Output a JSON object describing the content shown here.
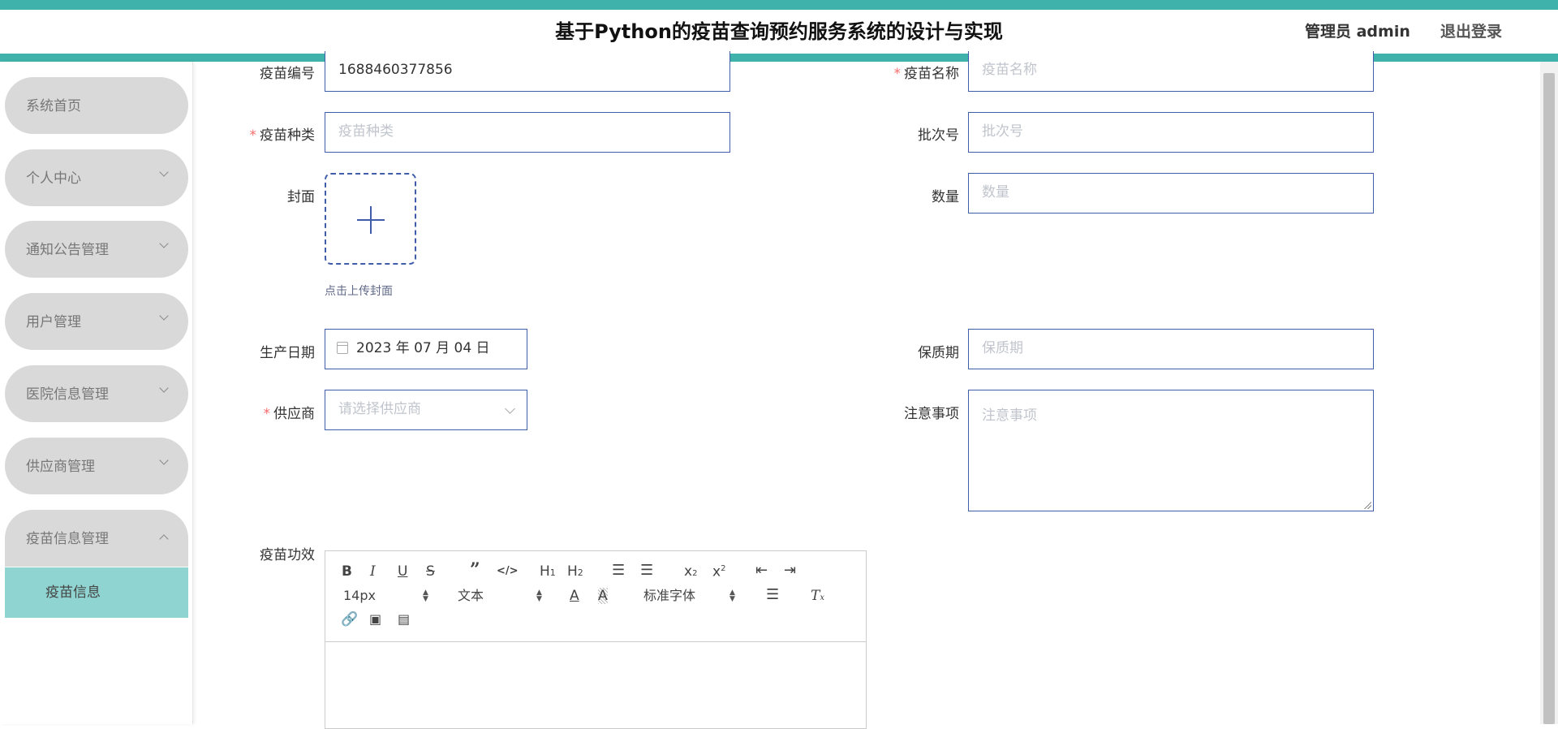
{
  "header": {
    "title": "基于Python的疫苗查询预约服务系统的设计与实现",
    "admin_label": "管理员 admin",
    "logout_label": "退出登录",
    "accent_color": "#3fb3ab"
  },
  "sidebar": {
    "items": [
      {
        "label": "系统首页",
        "chevron": "none"
      },
      {
        "label": "个人中心",
        "chevron": "chevron-down-icon"
      },
      {
        "label": "通知公告管理",
        "chevron": "chevron-down-icon"
      },
      {
        "label": "用户管理",
        "chevron": "chevron-down-icon"
      },
      {
        "label": "医院信息管理",
        "chevron": "chevron-down-icon"
      },
      {
        "label": "供应商管理",
        "chevron": "chevron-down-icon"
      },
      {
        "label": "疫苗信息管理",
        "chevron": "chevron-up-icon"
      }
    ],
    "active_subitem": "疫苗信息",
    "active_color": "#8fd4d0"
  },
  "form": {
    "vaccine_code": {
      "label": "疫苗编号",
      "value": "1688460377856"
    },
    "vaccine_name": {
      "label": "疫苗名称",
      "placeholder": "疫苗名称",
      "required": "*"
    },
    "vaccine_type": {
      "label": "疫苗种类",
      "placeholder": "疫苗种类",
      "required": "*"
    },
    "batch_no": {
      "label": "批次号",
      "placeholder": "批次号"
    },
    "cover": {
      "label": "封面",
      "hint": "点击上传封面",
      "icon": "plus-icon"
    },
    "quantity": {
      "label": "数量",
      "placeholder": "数量"
    },
    "production_date": {
      "label": "生产日期",
      "value": "2023 年 07 月 04 日",
      "icon": "calendar-icon"
    },
    "shelf_life": {
      "label": "保质期",
      "placeholder": "保质期"
    },
    "supplier": {
      "label": "供应商",
      "placeholder": "请选择供应商",
      "required": "*"
    },
    "notes": {
      "label": "注意事项",
      "placeholder": "注意事项"
    },
    "efficacy": {
      "label": "疫苗功效"
    }
  },
  "editor": {
    "font_size": "14px",
    "block_format": "文本",
    "font_family": "标准字体",
    "toolbar_icons": [
      "bold-icon",
      "italic-icon",
      "underline-icon",
      "strike-icon",
      "blockquote-icon",
      "code-block-icon",
      "h1-icon",
      "h2-icon",
      "ordered-list-icon",
      "bullet-list-icon",
      "subscript-icon",
      "superscript-icon",
      "outdent-icon",
      "indent-icon",
      "font-color-icon",
      "background-color-icon",
      "align-icon",
      "clear-format-icon",
      "link-icon",
      "image-icon",
      "video-icon"
    ]
  }
}
